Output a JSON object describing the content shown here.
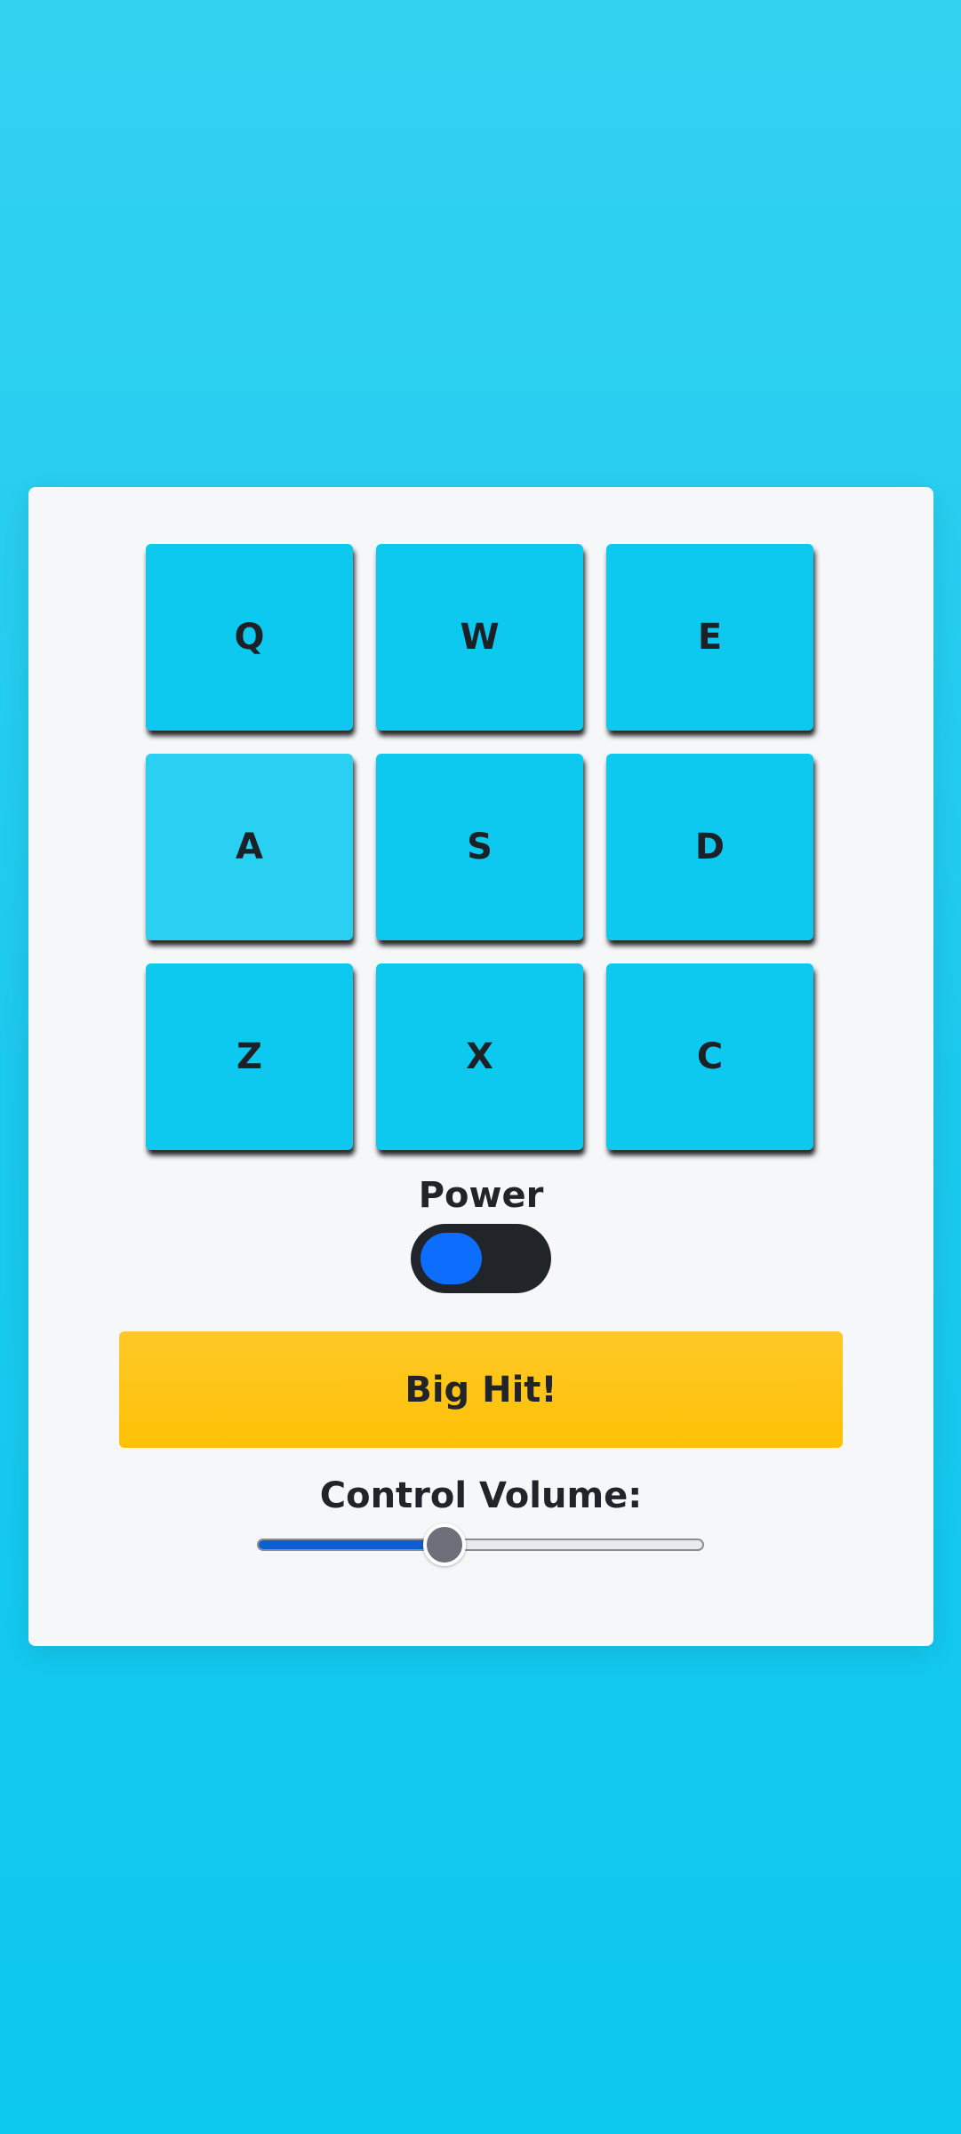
{
  "drum_machine": {
    "pads": [
      "Q",
      "W",
      "E",
      "A",
      "S",
      "D",
      "Z",
      "X",
      "C"
    ],
    "active_pad": "A",
    "power": {
      "label": "Power",
      "on": true
    },
    "big_hit_label": "Big Hit!",
    "volume": {
      "label": "Control Volume:",
      "level": 0.41
    }
  },
  "colors": {
    "background": "#0dc8ef",
    "card": "#f6f7f9",
    "pad": "#0dc8ef",
    "pad_active": "#2ad0f1",
    "toggle_track": "#212529",
    "toggle_knob": "#0d6efd",
    "big_hit": "#ffc107",
    "slider_fill": "#0b5fd1",
    "slider_thumb": "#6d6f7a"
  }
}
